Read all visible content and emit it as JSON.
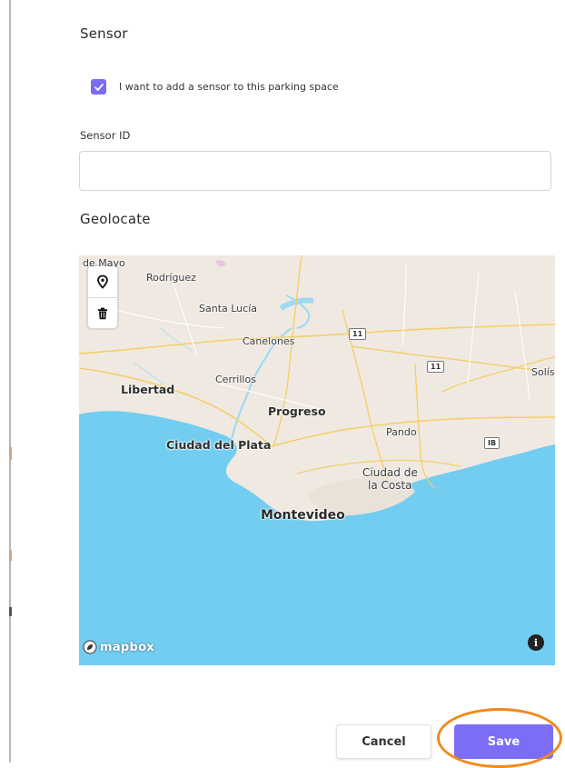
{
  "sensor_section": {
    "title": "Sensor",
    "checkbox_label": "I want to add a sensor to this parking space",
    "checkbox_checked": true,
    "sensor_id_label": "Sensor ID",
    "sensor_id_value": "",
    "sensor_id_placeholder": ""
  },
  "geolocate": {
    "title": "Geolocate",
    "map_labels": {
      "de_mayo": "de Mayo",
      "rodriguez": "Rodríguez",
      "santa_lucia": "Santa Lucía",
      "canelones": "Canelones",
      "cerrillos": "Cerrillos",
      "libertad": "Libertad",
      "progreso": "Progreso",
      "pando": "Pando",
      "solis": "Solís",
      "ciudad_del_plata": "Ciudad del Plata",
      "ciudad_de": "Ciudad de",
      "la_costa": "la Costa",
      "montevideo": "Montevideo"
    },
    "route_shields": {
      "r11_a": "11",
      "r11_b": "11",
      "rib": "IB"
    },
    "attribution": "mapbox",
    "colors": {
      "water": "#72cdf0",
      "land": "#efe9e1",
      "roads": "#f3cf6a"
    }
  },
  "actions": {
    "cancel_label": "Cancel",
    "save_label": "Save"
  },
  "theme": {
    "accent": "#7b6df6",
    "highlight": "#f08a1c"
  }
}
